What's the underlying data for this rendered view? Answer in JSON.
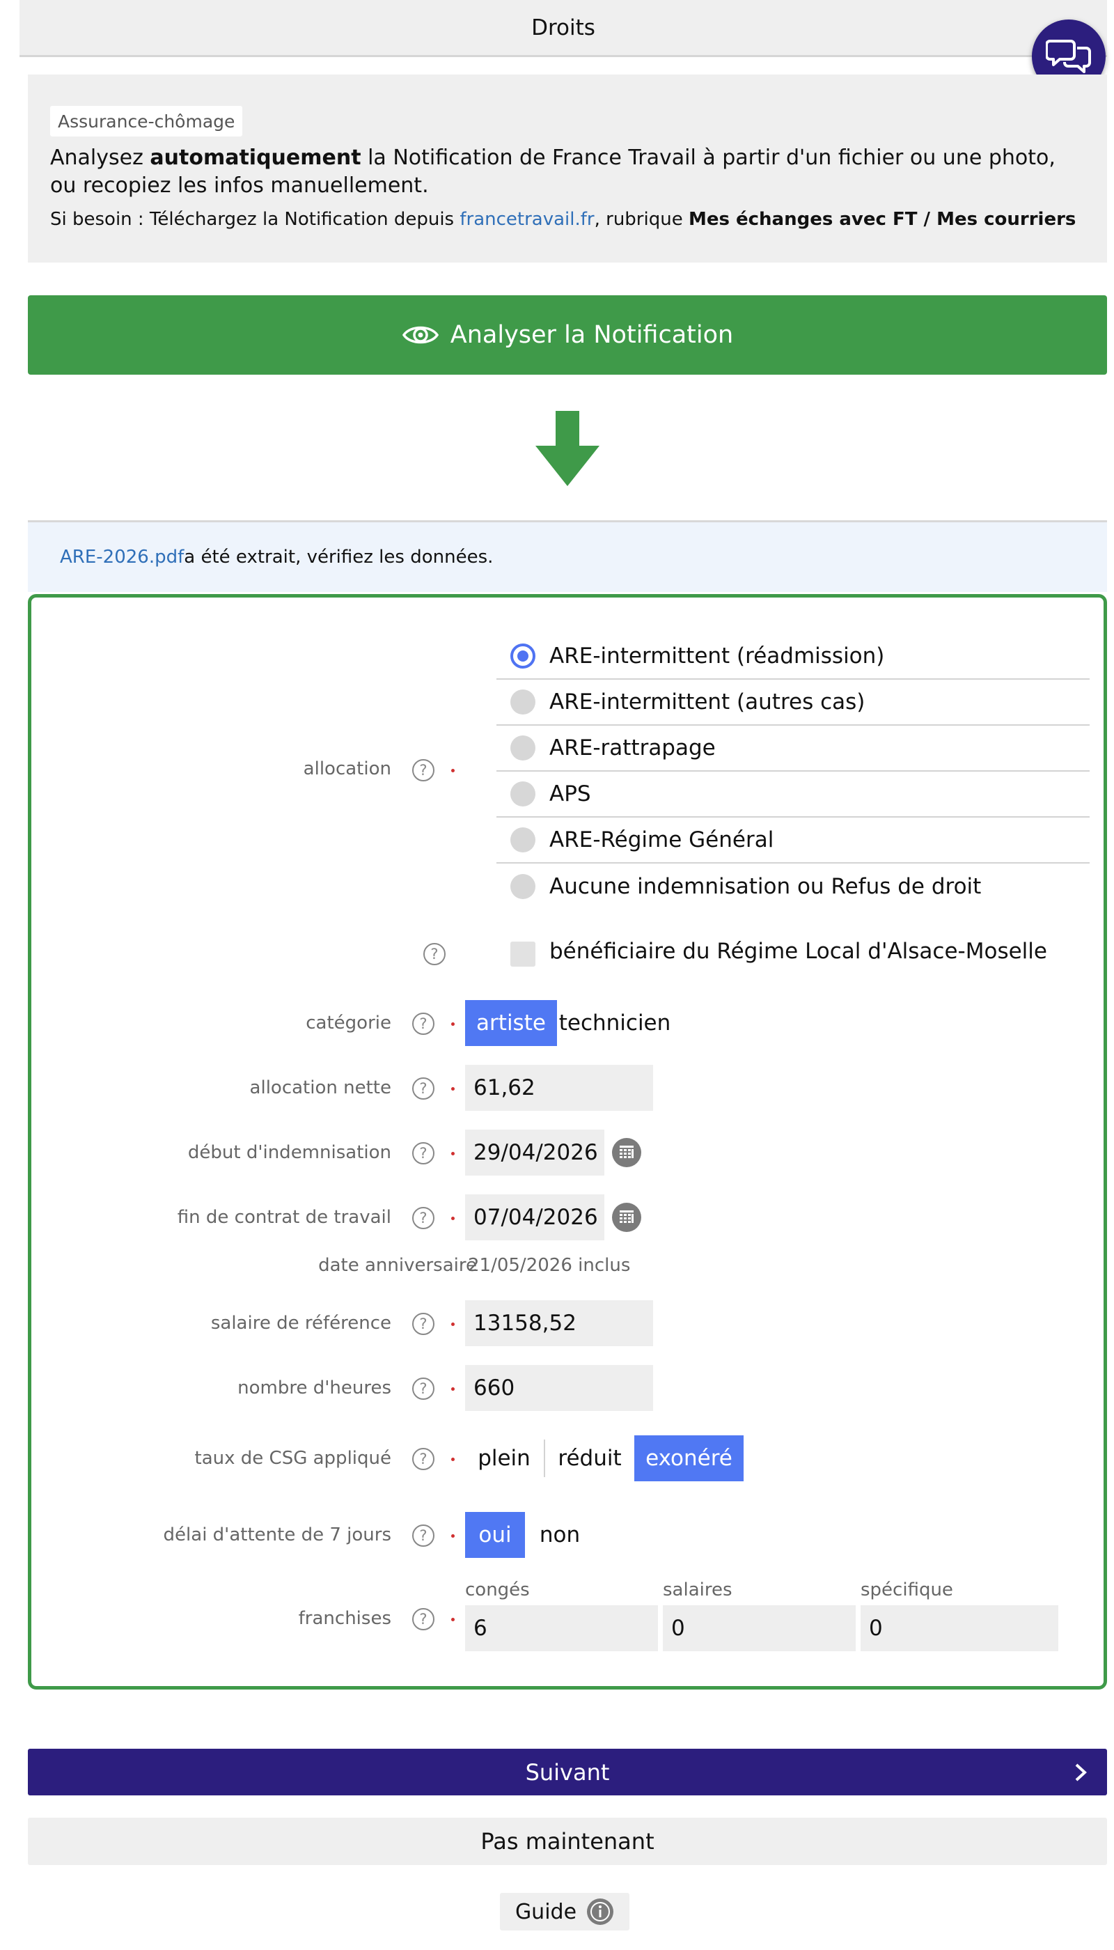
{
  "header": {
    "title": "Droits"
  },
  "info": {
    "tag": "Assurance-chômage",
    "line_prefix": "Analysez ",
    "line_bold": "automatiquement",
    "line_rest": " la Notification de France Travail à partir d'un fichier ou une photo, ou recopiez les infos manuellement.",
    "sub_prefix": "Si besoin : Téléchargez la Notification depuis ",
    "sub_link": "francetravail.fr",
    "sub_mid": ", rubrique ",
    "sub_bold": "Mes échanges avec FT / Mes courriers"
  },
  "analyze_button": {
    "label": "Analyser la Notification"
  },
  "extract": {
    "file": "ARE-2026.pdf",
    "message": " a été extrait, vérifiez les données."
  },
  "form": {
    "allocation": {
      "label": "allocation",
      "options": [
        "ARE-intermittent (réadmission)",
        "ARE-intermittent (autres cas)",
        "ARE-rattrapage",
        "APS",
        "ARE-Régime Général",
        "Aucune indemnisation ou Refus de droit"
      ],
      "selected": "ARE-intermittent (réadmission)"
    },
    "alsace": {
      "label": "bénéficiaire du Régime Local d'Alsace-Moselle",
      "checked": false
    },
    "categorie": {
      "label": "catégorie",
      "options": [
        "artiste",
        "technicien"
      ],
      "selected": "artiste"
    },
    "allocation_nette": {
      "label": "allocation nette",
      "value": "61,62"
    },
    "debut": {
      "label": "début d'indemnisation",
      "value": "29/04/2026"
    },
    "fin_contrat": {
      "label": "fin de contrat de travail",
      "value": "07/04/2026"
    },
    "anniversaire": {
      "label": "date anniversaire",
      "value": "21/05/2026 inclus"
    },
    "salaire_ref": {
      "label": "salaire de référence",
      "value": "13158,52"
    },
    "heures": {
      "label": "nombre d'heures",
      "value": "660"
    },
    "csg": {
      "label": "taux de CSG appliqué",
      "options": [
        "plein",
        "réduit",
        "exonéré"
      ],
      "selected": "exonéré"
    },
    "delai": {
      "label": "délai d'attente de 7 jours",
      "options": [
        "oui",
        "non"
      ],
      "selected": "oui"
    },
    "franchises": {
      "label": "franchises",
      "conges_label": "congés",
      "conges_value": "6",
      "salaires_label": "salaires",
      "salaires_value": "0",
      "specifique_label": "spécifique",
      "specifique_value": "0"
    },
    "help_glyph": "?"
  },
  "buttons": {
    "next": "Suivant",
    "later": "Pas maintenant",
    "guide": "Guide"
  },
  "colors": {
    "green": "#3f9a49",
    "navy": "#2c1e7e",
    "blue": "#5078f3",
    "link": "#2f6fb8"
  }
}
